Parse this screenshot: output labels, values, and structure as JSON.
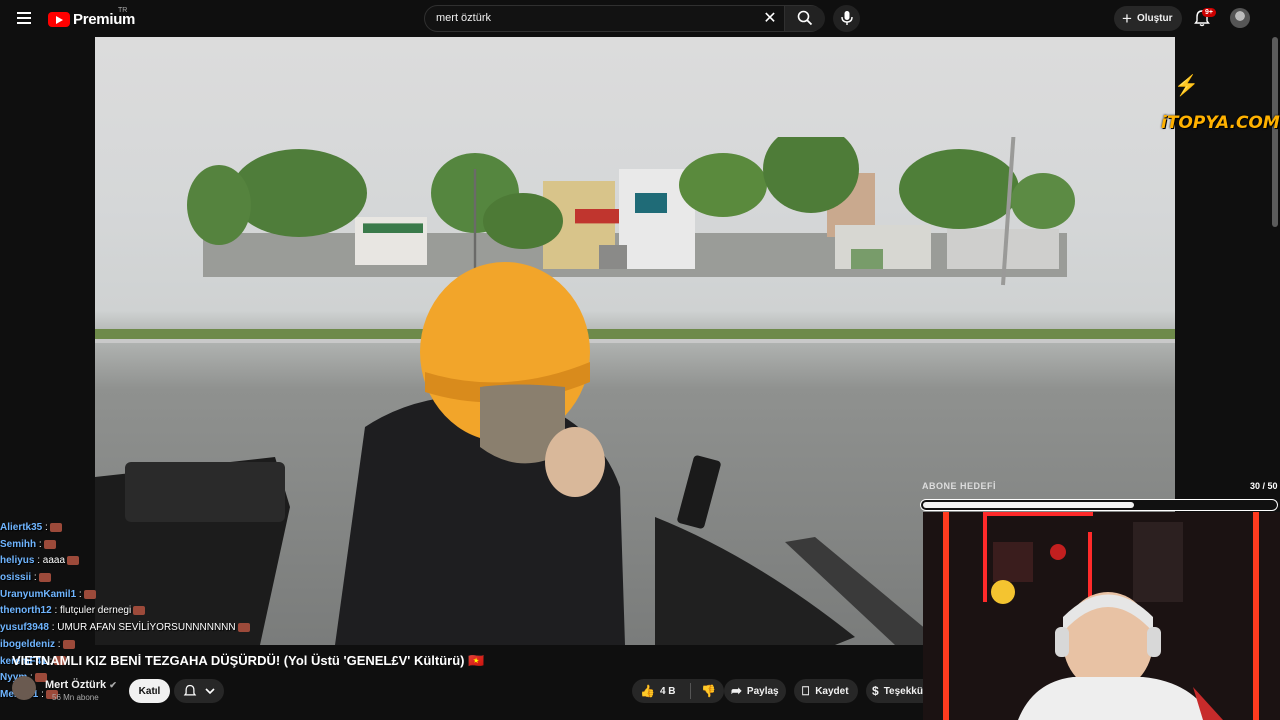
{
  "header": {
    "logo_text": "Premium",
    "region": "TR",
    "search_value": "mert öztürk",
    "create_label": "Oluştur",
    "notifications_badge": "9+"
  },
  "overlay": {
    "brand_text": "iTOPYA.COM",
    "goal_label": "ABONE HEDEFİ",
    "goal_count": "30 / 50",
    "goal_progress": 0.6
  },
  "chat": [
    {
      "user": "Aliertk35",
      "msg": ":"
    },
    {
      "user": "Semihh",
      "msg": ":"
    },
    {
      "user": "heliyus",
      "msg": ": aaaa"
    },
    {
      "user": "osissii",
      "msg": ":"
    },
    {
      "user": "UranyumKamil1",
      "msg": ":"
    },
    {
      "user": "thenorth12",
      "msg": ": flutçuler dernegi"
    },
    {
      "user": "yusuf3948",
      "msg": ": UMUR AFAN SEVİLİYORSUNNNNNNN"
    },
    {
      "user": "ibogeldeniz",
      "msg": ":"
    },
    {
      "user": "keremF41",
      "msg": ":"
    },
    {
      "user": "Nyym",
      "msg": ":"
    },
    {
      "user": "Merth61",
      "msg": ":"
    }
  ],
  "video": {
    "title": "VIETNAMLI KIZ BENİ TEZGAHA DÜŞÜRDÜ! (Yol Üstü 'GENEL£V' Kültürü) 🇻🇳",
    "channel_name": "Mert Öztürk",
    "subscribers": "56 Mn abone",
    "join_label": "Katıl",
    "likes": "4 B",
    "share_label": "Paylaş",
    "save_label": "Kaydet",
    "thanks_label": "Teşekkü"
  }
}
